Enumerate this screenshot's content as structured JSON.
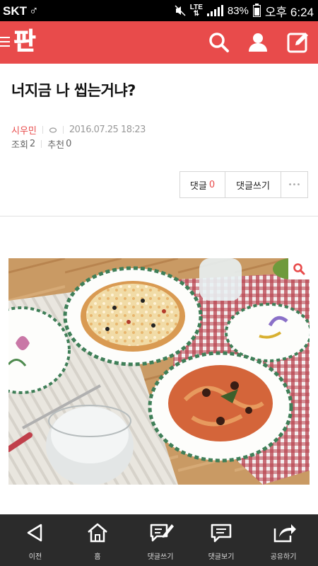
{
  "status_bar": {
    "carrier": "SKT",
    "network": "LTE",
    "battery": "83%",
    "time": "오후 6:24"
  },
  "app_bar": {
    "logo_text": "판",
    "icons": [
      "menu-icon",
      "search-icon",
      "user-icon",
      "write-icon"
    ]
  },
  "post": {
    "title": "너지금 나 씹는거냐?",
    "author": "시우민",
    "date": "2016.07.25 18:23",
    "views_label": "조회",
    "views": "2",
    "recommend_label": "추천",
    "recommend": "0"
  },
  "actions": {
    "comment_label": "댓글",
    "comment_count": "0",
    "write_comment_label": "댓글쓰기",
    "more_label": "•••"
  },
  "photo": {
    "zoom_icon": "zoom-icon"
  },
  "bottom_nav": {
    "items": [
      {
        "label": "이전",
        "icon": "back-icon"
      },
      {
        "label": "홈",
        "icon": "home-icon"
      },
      {
        "label": "댓글쓰기",
        "icon": "write-comment-icon"
      },
      {
        "label": "댓글보기",
        "icon": "view-comments-icon"
      },
      {
        "label": "공유하기",
        "icon": "share-icon"
      }
    ]
  },
  "colors": {
    "accent": "#e84b4b",
    "bottom_bar": "#2b2b2b",
    "status_bar": "#000000"
  }
}
